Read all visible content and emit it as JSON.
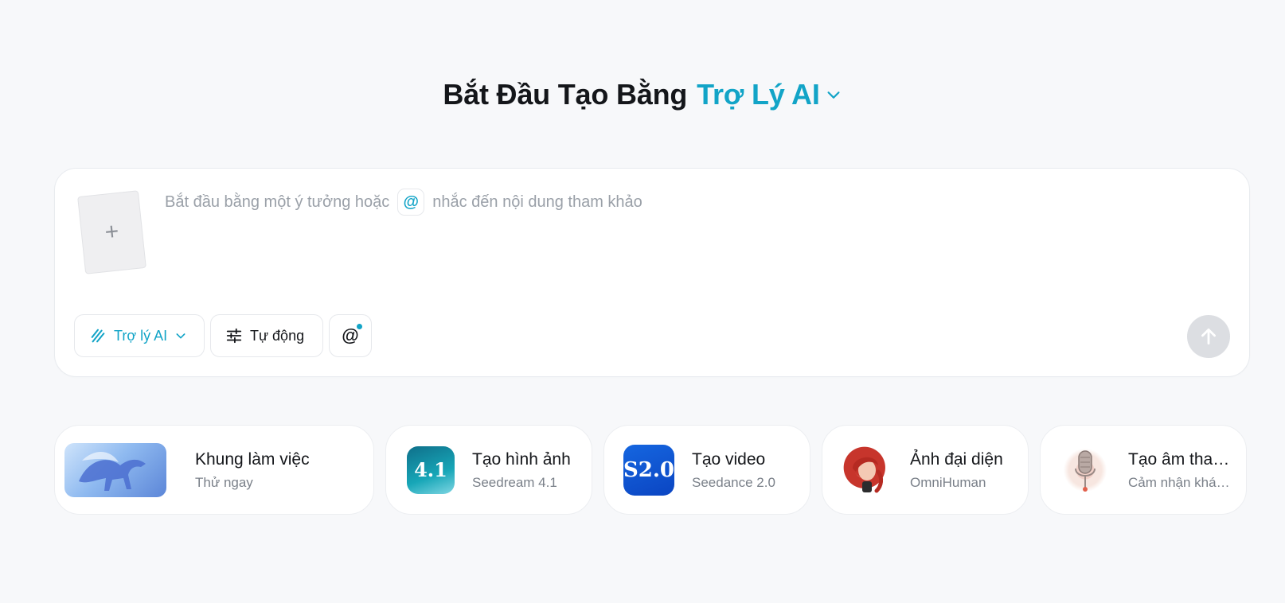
{
  "headline": {
    "prefix": "Bắt Đầu Tạo Bằng",
    "accent": "Trợ Lý AI"
  },
  "composer": {
    "upload_symbol": "+",
    "placeholder_before": "Bắt đầu bằng một ý tưởng hoặc",
    "placeholder_at": "@",
    "placeholder_after": "nhắc đến nội dung tham khảo",
    "toolbar": {
      "assistant_label": "Trợ lý AI",
      "auto_label": "Tự động",
      "mention_label": "@"
    },
    "send_icon": "arrow-up-icon"
  },
  "cards": [
    {
      "title": "Khung làm việc",
      "subtitle": "Thử ngay",
      "icon": "pegasus-thumbnail"
    },
    {
      "title": "Tạo hình ảnh",
      "subtitle": "Seedream 4.1",
      "icon": "seedream-thumbnail",
      "badge": "4.1"
    },
    {
      "title": "Tạo video",
      "subtitle": "Seedance 2.0",
      "icon": "seedance-thumbnail",
      "badge": "S2.0"
    },
    {
      "title": "Ảnh đại diện",
      "subtitle": "OmniHuman",
      "icon": "avatar-thumbnail"
    },
    {
      "title": "Tạo âm thanh",
      "subtitle": "Cảm nhận khác biệt",
      "icon": "microphone-thumbnail"
    }
  ],
  "colors": {
    "accent": "#12a4c7",
    "background": "#f7f8fa",
    "send_disabled": "#dcdee2"
  }
}
